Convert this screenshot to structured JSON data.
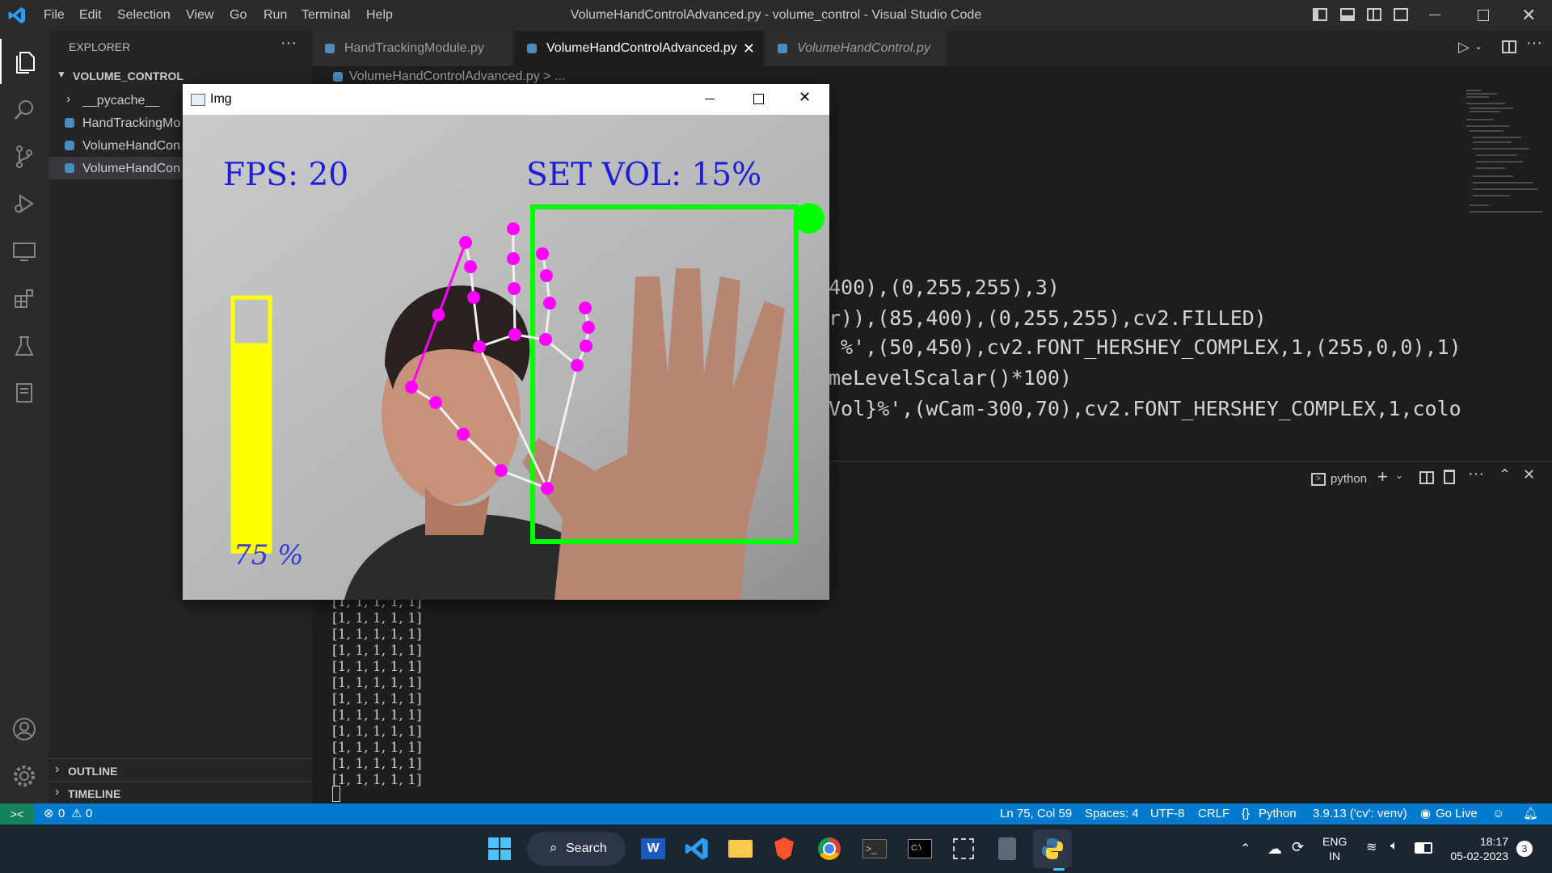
{
  "window_title": "VolumeHandControlAdvanced.py - volume_control - Visual Studio Code",
  "menu": [
    "File",
    "Edit",
    "Selection",
    "View",
    "Go",
    "Run",
    "Terminal",
    "Help"
  ],
  "sidebar": {
    "header": "EXPLORER",
    "folder": "VOLUME_CONTROL",
    "items": [
      "__pycache__",
      "HandTrackingMo",
      "VolumeHandCon",
      "VolumeHandCon"
    ],
    "outline": "OUTLINE",
    "timeline": "TIMELINE"
  },
  "tabs": [
    "HandTrackingModule.py",
    "VolumeHandControlAdvanced.py",
    "VolumeHandControl.py"
  ],
  "breadcrumb": "VolumeHandControlAdvanced.py > ...",
  "code_lines": [
    "400),(0,255,255),3)",
    "r)),(85,400),(0,255,255),cv2.FILLED)",
    " %',(50,450),cv2.FONT_HERSHEY_COMPLEX,1,(255,0,0),1)",
    "meLevelScalar()*100)",
    "Vol}%',(wCam-300,70),cv2.FONT_HERSHEY_COMPLEX,1,colo"
  ],
  "terminal": {
    "label": "python",
    "lines": [
      "[1, 1, 1, 1, 1]",
      "[1, 1, 1, 1, 1]",
      "[1, 1, 1, 1, 1]",
      "[1, 1, 1, 1, 1]",
      "[1, 1, 1, 1, 1]",
      "[1, 1, 1, 1, 1]",
      "[1, 1, 1, 1, 1]",
      "[1, 1, 1, 1, 1]",
      "[1, 1, 1, 1, 1]",
      "[1, 1, 1, 1, 1]",
      "[1, 1, 1, 1, 1]",
      "[1, 1, 1, 1, 1]"
    ]
  },
  "img_window": {
    "title": "Img",
    "fps_text": "FPS: 20",
    "set_vol_text": "SET VOL: 15%",
    "vol_percent_text": "75 %",
    "volume_bar_level": 0.82
  },
  "status": {
    "errors": "0",
    "warnings": "0",
    "position": "Ln 75, Col 59",
    "spaces": "Spaces: 4",
    "encoding": "UTF-8",
    "eol": "CRLF",
    "language": "Python",
    "interpreter": "3.9.13 ('cv': venv)",
    "golive": "Go Live"
  },
  "taskbar": {
    "search": "Search",
    "lang": "ENG",
    "region": "IN",
    "time": "18:17",
    "date": "05-02-2023",
    "notif": "3"
  },
  "colors": {
    "accent": "#007acc",
    "green": "#00ff00",
    "magenta": "#ff00ff",
    "yellow": "#ffff00",
    "blue_text": "#1d1dd8"
  }
}
